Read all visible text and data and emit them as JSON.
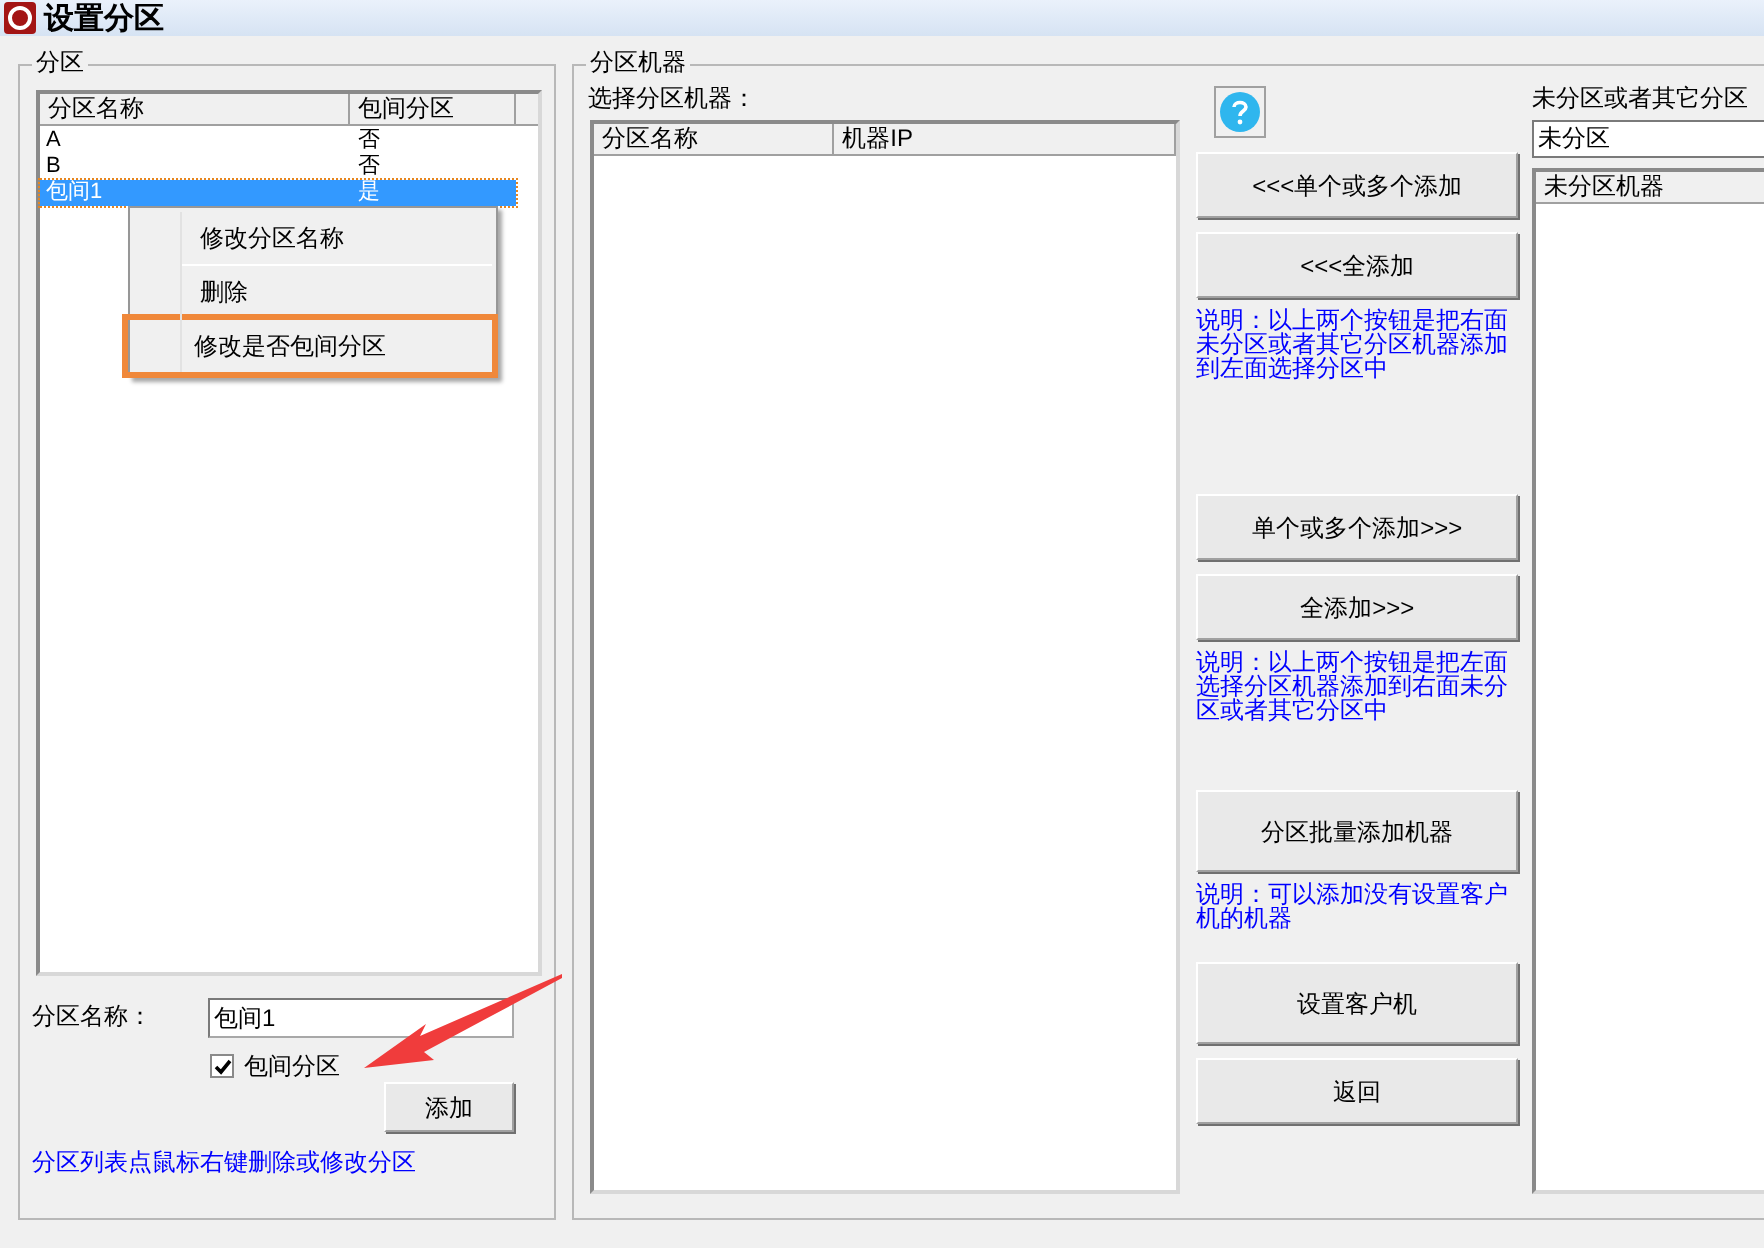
{
  "window": {
    "title": "设置分区"
  },
  "partition_group": {
    "title": "分区",
    "table": {
      "columns": [
        "分区名称",
        "包间分区"
      ],
      "rows": [
        {
          "name": "A",
          "private_room": "否",
          "selected": false
        },
        {
          "name": "B",
          "private_room": "否",
          "selected": false
        },
        {
          "name": "包间1",
          "private_room": "是",
          "selected": true
        }
      ]
    },
    "context_menu": {
      "items": [
        {
          "label": "修改分区名称",
          "highlighted": false
        },
        {
          "label": "删除",
          "highlighted": false
        },
        {
          "label": "修改是否包间分区",
          "highlighted": true
        }
      ]
    },
    "name_label": "分区名称：",
    "name_value": "包间1",
    "private_room_checkbox": {
      "label": "包间分区",
      "checked": true
    },
    "add_button": "添加",
    "hint": "分区列表点鼠标右键删除或修改分区"
  },
  "machines_group": {
    "title": "分区机器",
    "list_label": "选择分区机器：",
    "table": {
      "columns": [
        "分区名称",
        "机器IP"
      ]
    }
  },
  "action_sections": [
    [
      {
        "kind": "help"
      },
      {
        "kind": "button",
        "label": "<<<单个或多个添加"
      },
      {
        "kind": "button",
        "label": "<<<全添加"
      },
      {
        "kind": "note",
        "text": "说明：以上两个按钮是把右面未分区或者其它分区机器添加到左面选择分区中"
      }
    ],
    [
      {
        "kind": "button",
        "label": "单个或多个添加>>>"
      },
      {
        "kind": "button",
        "label": "全添加>>>"
      },
      {
        "kind": "note",
        "text": "说明：以上两个按钮是把左面选择分区机器添加到右面未分区或者其它分区中"
      }
    ],
    [
      {
        "kind": "tall_button",
        "label": "分区批量添加机器"
      },
      {
        "kind": "note",
        "text": "说明：可以添加没有设置客户机的机器"
      }
    ],
    [
      {
        "kind": "tall_button",
        "label": "设置客户机"
      },
      {
        "kind": "button",
        "label": "返回"
      }
    ]
  ],
  "right_panel": {
    "label": "未分区或者其它分区",
    "combo_value": "未分区",
    "table": {
      "columns": [
        "未分区机器"
      ]
    }
  }
}
